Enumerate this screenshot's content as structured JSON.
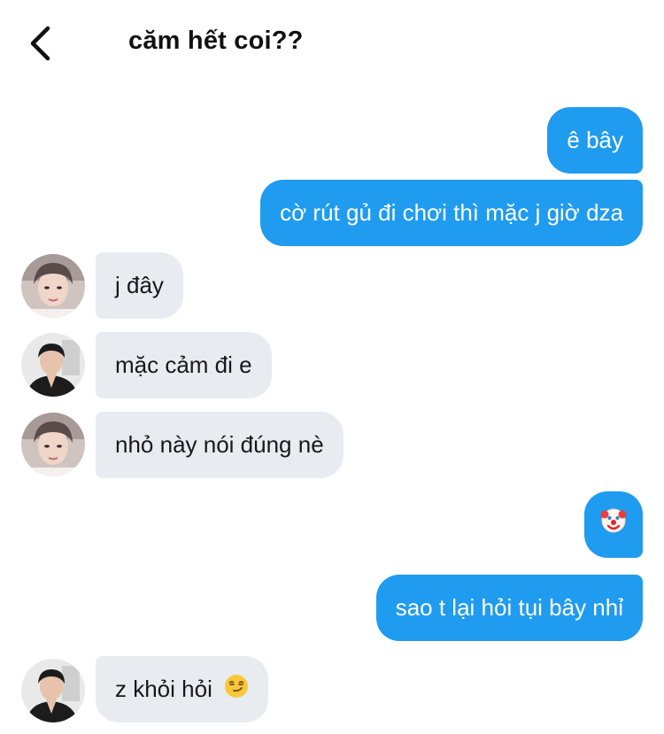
{
  "header": {
    "title": "căm hết coi??"
  },
  "messages": [
    {
      "text": "ê bây"
    },
    {
      "text": "cờ rút gủ đi chơi thì mặc j giờ dza"
    },
    {
      "text": "j đây"
    },
    {
      "text": "mặc cảm đi e"
    },
    {
      "text": "nhỏ này nói đúng nè"
    },
    {
      "text": "",
      "emoji": "clown-face"
    },
    {
      "text": "sao t lại hỏi tụi bây nhỉ"
    },
    {
      "text": "z khỏi hỏi",
      "emoji": "smirking-face"
    }
  ],
  "colors": {
    "outgoing": "#1f9bf0",
    "incoming": "#e8ecf1"
  }
}
